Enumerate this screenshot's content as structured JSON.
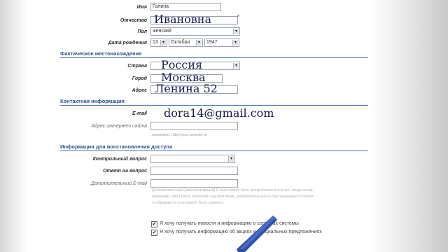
{
  "form": {
    "first_name": {
      "label": "Имя",
      "value": "Галина"
    },
    "patronymic": {
      "label": "Отчество",
      "value": "Ивановна"
    },
    "gender": {
      "label": "Пол",
      "value": "женский"
    },
    "birth_date": {
      "label": "Дата рождения",
      "day": "13",
      "month": "Октября",
      "year": "1947"
    },
    "residence": {
      "section": "Фактическое местонахождение",
      "country": {
        "label": "Страна",
        "value": "Россия"
      },
      "city": {
        "label": "Город",
        "value": "Москва"
      },
      "address": {
        "label": "Адрес",
        "value": "Ленина 52"
      }
    },
    "contacts": {
      "section": "Контактная информация",
      "email": {
        "label": "E-mail",
        "value": "dora14@gmail.com"
      },
      "website": {
        "label": "Адрес интернет сайта",
        "value": "",
        "hint": "например: http://your.website.ru"
      }
    },
    "recovery": {
      "section": "Информация для восстановления доступа",
      "question": {
        "label": "Контрольный вопрос",
        "value": ""
      },
      "answer": {
        "label": "Ответ на вопрос",
        "value": ""
      },
      "extra_email": {
        "label": "Дополнительный E-mail",
        "value": ""
      },
      "note_line1": "Дополнительный (альтернативный) E-mail может быть востребован в случае, когда основ",
      "note_line2": "например, при утрате контроля над почтовым, дополнительный E-mail указывается после",
      "note_line3": "отображается и не может быть изменен."
    },
    "subscriptions": [
      {
        "label": "Я хочу получать новости и информацию о сервисах системы",
        "checked": true
      },
      {
        "label": "Я хочу получать информацию об акциях и специальных предложениях",
        "checked": true
      }
    ]
  },
  "icons": {
    "dropdown": "chevron-down-icon",
    "checkmark": "check-icon"
  },
  "colors": {
    "section": "#2d4f86",
    "rule": "#4b78b9",
    "ink": "#1a1a4e",
    "pen": "#2f4fa8"
  }
}
